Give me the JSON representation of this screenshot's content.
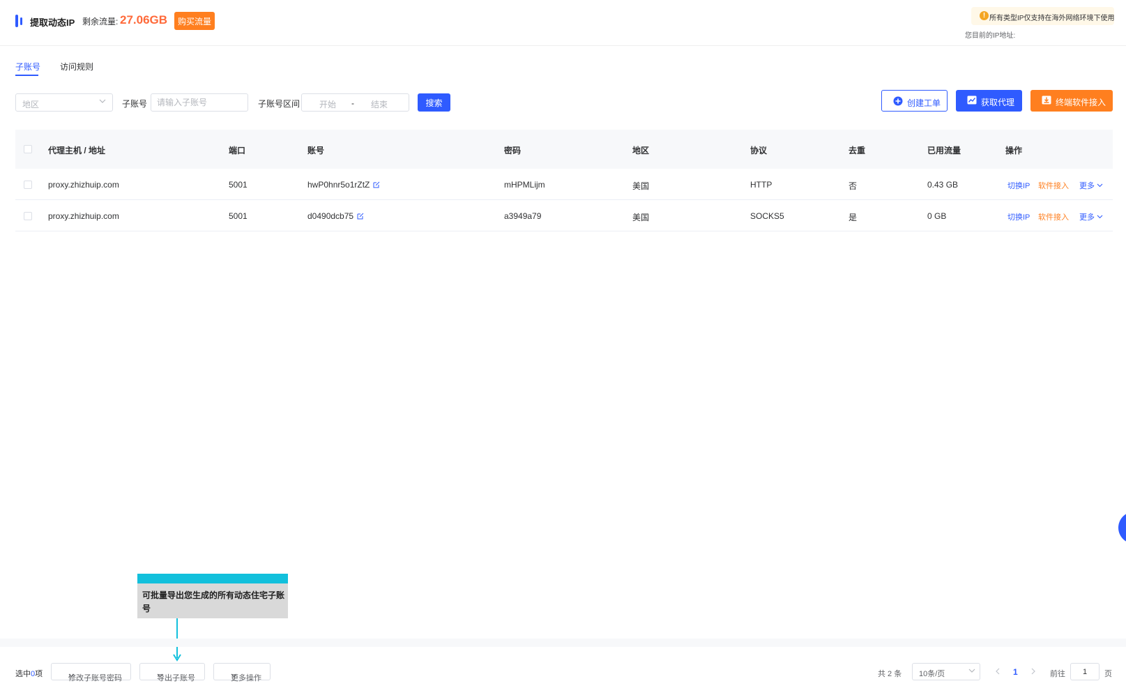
{
  "header": {
    "title": "提取动态IP",
    "remain_label": "剩余流量:",
    "remain_value": "27.06GB",
    "buy_label": "购买流量",
    "notice_icon": "!",
    "notice": "所有类型IP仅支持在海外网络环境下使用",
    "ip_label": "您目前的IP地址:"
  },
  "tabs": [
    {
      "label": "子账号",
      "active": true
    },
    {
      "label": "访问规则",
      "active": false
    }
  ],
  "filters": {
    "region_placeholder": "地区",
    "sub_account_label": "子账号",
    "sub_account_placeholder": "请输入子账号",
    "range_label": "子账号区间",
    "range_start": "开始",
    "range_sep": "-",
    "range_end": "结束",
    "search_label": "搜索"
  },
  "actions": {
    "create_ticket": "创建工单",
    "get_proxy": "获取代理",
    "terminal_access": "终端软件接入"
  },
  "table": {
    "columns": [
      "代理主机 / 地址",
      "端口",
      "账号",
      "密码",
      "地区",
      "协议",
      "去重",
      "已用流量",
      "操作"
    ],
    "rows": [
      {
        "host": "proxy.zhizhuip.com",
        "port": "5001",
        "account": "hwP0hnr5o1rZtZ",
        "password": "mHPMLijm",
        "region": "美国",
        "protocol": "HTTP",
        "dedup": "否",
        "used": "0.43 GB"
      },
      {
        "host": "proxy.zhizhuip.com",
        "port": "5001",
        "account": "d0490dcb75",
        "password": "a3949a79",
        "region": "美国",
        "protocol": "SOCKS5",
        "dedup": "是",
        "used": "0 GB"
      }
    ],
    "op_switch": "切换IP",
    "op_soft": "软件接入",
    "op_more": "更多"
  },
  "callout": {
    "text": "可批量导出您生成的所有动态住宅子账号"
  },
  "footer": {
    "selected_prefix": "选中",
    "selected_count": "0",
    "selected_suffix": "项",
    "modify_password": "修改子账号密码",
    "export": "导出子账号",
    "more_ops": "更多操作",
    "total": "共 2 条",
    "page_size": "10条/页",
    "current_page": "1",
    "goto_label": "前往",
    "goto_value": "1",
    "page_suffix": "页"
  },
  "colors": {
    "primary": "#2f5bff",
    "orange": "#ff7f1f",
    "traffic": "#ff6a3a",
    "callout": "#12c0dc"
  }
}
